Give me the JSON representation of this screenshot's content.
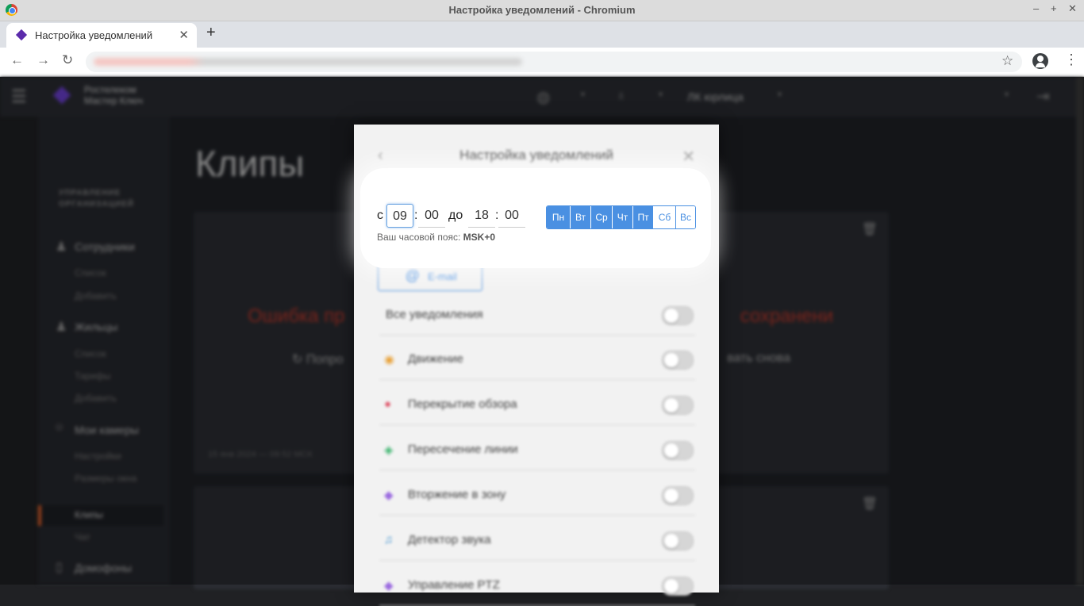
{
  "window": {
    "title": "Настройка уведомлений - Chromium",
    "controls": [
      "–",
      "+",
      "✕"
    ]
  },
  "tab": {
    "label": "Настройка уведомлений",
    "close": "✕",
    "new": "+"
  },
  "toolbar": {
    "back": "←",
    "forward": "→",
    "reload": "↻",
    "star": "☆",
    "menu": "⋮"
  },
  "topnav": {
    "menu_glyph": "☰",
    "brand_line1": "Ростелеком",
    "brand_line2": "Мастер Ключ",
    "cabinet": "ЛК юрлица",
    "caret": "▾",
    "logout_glyph": "⇥"
  },
  "sidebar": {
    "group": [
      "УПРАВЛЕНИЕ",
      "ОРГАНИЗАЦИЕЙ"
    ],
    "items": [
      {
        "label": "Сотрудники",
        "subs": [
          "Список",
          "Добавить"
        ]
      },
      {
        "label": "Жильцы",
        "subs": [
          "Список",
          "Тарифы",
          "Добавить"
        ]
      },
      {
        "label": "Мои камеры",
        "subs": [
          "Настройки",
          "Размеры окна",
          "Клипы",
          "Чат"
        ]
      },
      {
        "label": "Домофоны"
      }
    ]
  },
  "main": {
    "heading": "Клипы",
    "error_left": "Ошибка пр",
    "error_right": "сохранени",
    "retry_left": "↻ Попро",
    "retry_right": "вать снова",
    "date": "15 янв 2024 — 09:52 МСК",
    "trash": "🗑"
  },
  "modal": {
    "title": "Настройка уведомлений",
    "back": "‹",
    "close": "✕",
    "email_at": "@",
    "email_label": "E-mail",
    "rows": [
      {
        "icon": "",
        "color": "#444",
        "label": "Все уведомления"
      },
      {
        "icon": "◉",
        "color": "#e8a23a",
        "label": "Движение"
      },
      {
        "icon": "●",
        "color": "#e05a6e",
        "label": "Перекрытие обзора"
      },
      {
        "icon": "◈",
        "color": "#3cb46e",
        "label": "Пересечение линии"
      },
      {
        "icon": "◆",
        "color": "#9b6be0",
        "label": "Вторжение в зону"
      },
      {
        "icon": "♫",
        "color": "#3a8fd0",
        "label": "Детектор звука"
      },
      {
        "icon": "◆",
        "color": "#9b6be0",
        "label": "Управление PTZ"
      }
    ]
  },
  "schedule": {
    "from_label": "с",
    "to_label": "до",
    "from_hour": "09",
    "from_min": "00",
    "to_hour": "18",
    "to_min": "00",
    "colon": ":",
    "timezone_prefix": "Ваш часовой пояс:",
    "timezone_value": "MSK+0",
    "days": [
      {
        "label": "Пн",
        "active": true
      },
      {
        "label": "Вт",
        "active": true
      },
      {
        "label": "Ср",
        "active": true
      },
      {
        "label": "Чт",
        "active": true
      },
      {
        "label": "Пт",
        "active": true
      },
      {
        "label": "Сб",
        "active": false
      },
      {
        "label": "Вс",
        "active": false
      }
    ]
  }
}
